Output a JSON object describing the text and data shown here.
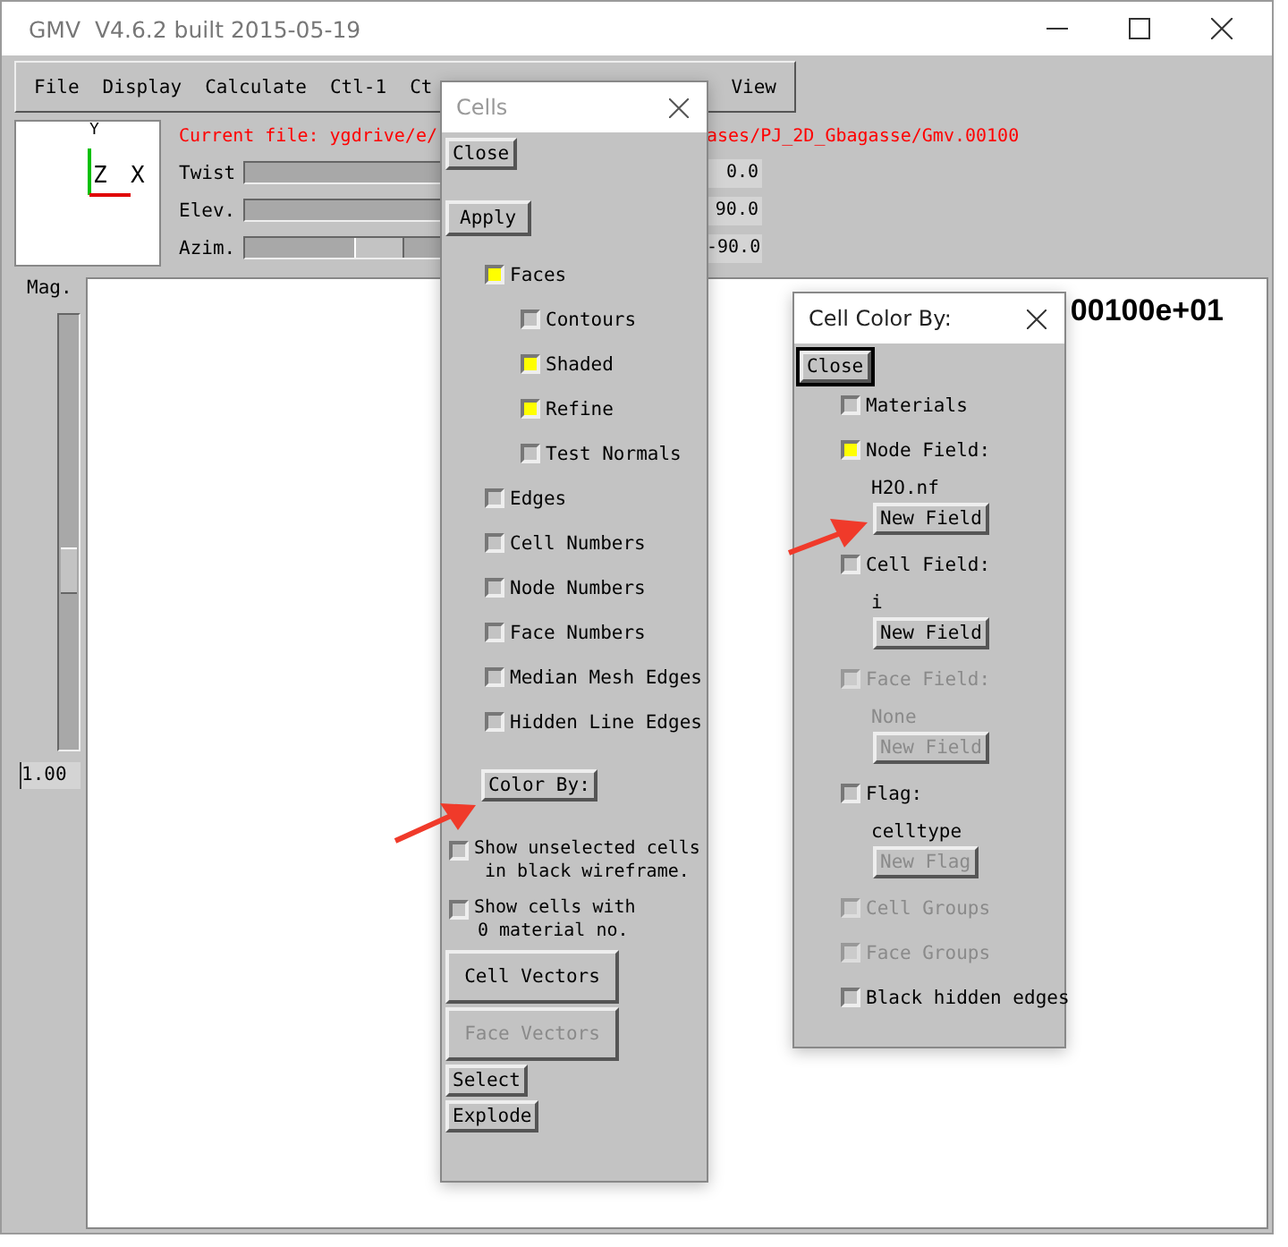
{
  "window": {
    "title": "GMV  V4.6.2 built 2015-05-19"
  },
  "menu": [
    {
      "label": "File"
    },
    {
      "label": "Display"
    },
    {
      "label": "Calculate"
    },
    {
      "label": "Ctl-1"
    },
    {
      "label": "Ct"
    },
    {
      "label": "View"
    }
  ],
  "current_file": [
    "Current file: ygdrive/e/",
    "ases/PJ_2D_Gbagasse/Gmv.00100"
  ],
  "axes": {
    "y": "Y",
    "z": "Z",
    "x": "X"
  },
  "sliders": [
    {
      "label": "Twist",
      "value": "0.0"
    },
    {
      "label": "Elev.",
      "value": "90.0"
    },
    {
      "label": "Azim.",
      "value": "-90.0",
      "level": 0.29
    }
  ],
  "mag": {
    "label": "Mag.",
    "value": "1.00",
    "level": 0.41
  },
  "scale_text": "00100e+01",
  "cells_dialog": {
    "title": "Cells",
    "close": "Close",
    "apply": "Apply",
    "options": [
      {
        "label": "Faces",
        "checked": true,
        "children": [
          {
            "label": "Contours",
            "checked": false
          },
          {
            "label": "Shaded",
            "checked": true
          },
          {
            "label": "Refine",
            "checked": true
          },
          {
            "label": "Test Normals",
            "checked": false
          }
        ]
      },
      {
        "label": "Edges",
        "checked": false
      },
      {
        "label": "Cell Numbers",
        "checked": false
      },
      {
        "label": "Node Numbers",
        "checked": false
      },
      {
        "label": "Face Numbers",
        "checked": false
      },
      {
        "label": "Median Mesh Edges",
        "checked": false
      },
      {
        "label": "Hidden Line Edges",
        "checked": false
      }
    ],
    "color_by": "Color By:",
    "show_options": [
      {
        "lines": [
          "Show unselected cells",
          "in black wireframe."
        ],
        "checked": false
      },
      {
        "lines": [
          "Show cells with",
          "0 material no."
        ],
        "checked": false
      }
    ],
    "buttons": [
      {
        "label": "Cell Vectors",
        "disabled": false,
        "kind": "wide"
      },
      {
        "label": "Face Vectors",
        "disabled": true,
        "kind": "wide"
      },
      {
        "label": "Select",
        "disabled": false,
        "kind": "small"
      },
      {
        "label": "Explode",
        "disabled": false,
        "kind": "small"
      }
    ]
  },
  "color_dialog": {
    "title": "Cell Color By:",
    "close": "Close",
    "items": [
      {
        "kind": "checkbox",
        "label": "Materials",
        "checked": false,
        "disabled": false
      },
      {
        "kind": "checkbox",
        "label": "Node Field:",
        "checked": true,
        "disabled": false
      },
      {
        "kind": "text",
        "label": "H2O.nf",
        "disabled": false
      },
      {
        "kind": "button",
        "label": "New Field",
        "disabled": false
      },
      {
        "kind": "checkbox",
        "label": "Cell Field:",
        "checked": false,
        "disabled": false
      },
      {
        "kind": "text",
        "label": "i",
        "disabled": false
      },
      {
        "kind": "button",
        "label": "New Field",
        "disabled": false
      },
      {
        "kind": "checkbox",
        "label": "Face Field:",
        "checked": false,
        "disabled": true
      },
      {
        "kind": "text",
        "label": "None",
        "disabled": true
      },
      {
        "kind": "button",
        "label": "New Field",
        "disabled": true
      },
      {
        "kind": "checkbox",
        "label": "Flag:",
        "checked": false,
        "disabled": false
      },
      {
        "kind": "text",
        "label": "celltype",
        "disabled": false
      },
      {
        "kind": "button",
        "label": "New Flag",
        "disabled": true
      },
      {
        "kind": "checkbox",
        "label": "Cell Groups",
        "checked": false,
        "disabled": true
      },
      {
        "kind": "checkbox",
        "label": "Face Groups",
        "checked": false,
        "disabled": true
      },
      {
        "kind": "checkbox",
        "label": "Black hidden edges",
        "checked": false,
        "disabled": false
      }
    ]
  }
}
